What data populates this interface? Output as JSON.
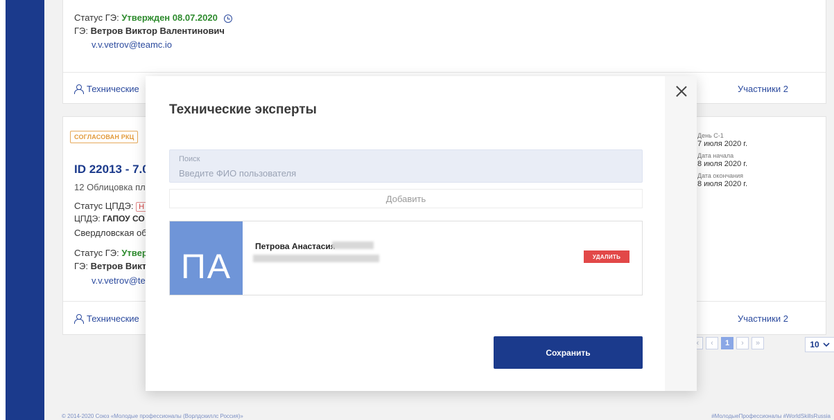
{
  "card1": {
    "status_ge_label": "Статус ГЭ:",
    "status_ge_value": "Утвержден 08.07.2020",
    "ge_label": "ГЭ:",
    "ge_name": "Ветров Виктор Валентинович",
    "ge_email": "v.v.vetrov@teamc.io",
    "experts_link": "Технические",
    "participants_link": "Участники 2"
  },
  "card2": {
    "badge": "СОГЛАСОВАН РКЦ",
    "id_title": "ID 22013 - 7.0",
    "discipline": "12 Облицовка пл",
    "status_cpde_label": "Статус ЦПДЭ:",
    "status_cpde_badge": "Н",
    "cpde_label": "ЦПДЭ:",
    "cpde_value": "ГАПОУ СО",
    "region": "Свердловская об",
    "status_ge_label": "Статус ГЭ:",
    "status_ge_value": "Утвер",
    "ge_label": "ГЭ:",
    "ge_name": "Ветров Викт",
    "ge_email": "v.v.vetrov@te",
    "experts_link": "Технические",
    "participants_link": "Участники 2",
    "dates": [
      {
        "label": "День С-1",
        "value": "7 июля 2020 г."
      },
      {
        "label": "Дата начала",
        "value": "8 июля 2020 г."
      },
      {
        "label": "Дата окончания",
        "value": "8 июля 2020 г."
      }
    ]
  },
  "pagination": {
    "first": "«",
    "prev": "‹",
    "current": "1",
    "next": "›",
    "last": "»",
    "per_page": "10"
  },
  "footer": {
    "copyright": "© 2014-2020 Союз «Молодые профессионалы (Ворлдскиллс Россия)»",
    "hashtags": "#МолодыеПрофессионалы #WorldSkillsRussia"
  },
  "modal": {
    "title": "Технические эксперты",
    "search_label": "Поиск",
    "search_placeholder": "Введите ФИО пользователя",
    "search_value": "",
    "add_label": "Добавить",
    "user": {
      "initials": "ПА",
      "name": "Петрова Анастасия",
      "delete_label": "УДАЛИТЬ"
    },
    "save_label": "Сохранить"
  }
}
